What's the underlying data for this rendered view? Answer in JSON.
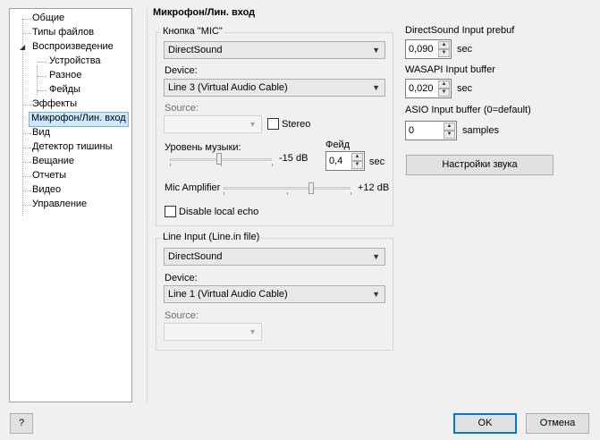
{
  "tree": {
    "items": [
      {
        "label": "Общие"
      },
      {
        "label": "Типы файлов"
      },
      {
        "label": "Воспроизведение",
        "expanded": true
      },
      {
        "label": "Устройства",
        "child": true
      },
      {
        "label": "Разное",
        "child": true
      },
      {
        "label": "Фейды",
        "child": true
      },
      {
        "label": "Эффекты"
      },
      {
        "label": "Микрофон/Лин. вход",
        "selected": true
      },
      {
        "label": "Вид"
      },
      {
        "label": "Детектор тишины"
      },
      {
        "label": "Вещание"
      },
      {
        "label": "Отчеты"
      },
      {
        "label": "Видео"
      },
      {
        "label": "Управление"
      }
    ],
    "expander_icon": "triangle-expanded-icon"
  },
  "section_title": "Микрофон/Лин. вход",
  "mic_group": {
    "title": "Кнопка \"MIC\"",
    "driver": "DirectSound",
    "device_label": "Device:",
    "device": "Line 3 (Virtual Audio Cable)",
    "source_label": "Source:",
    "source": "",
    "stereo_label": "Stereo",
    "stereo_checked": false,
    "music_level_label": "Уровень музыки:",
    "music_level_value": "-15 dB",
    "music_level_fraction": 0.48,
    "fade_label": "Фейд",
    "fade_value": "0,4",
    "fade_unit": "sec",
    "mic_amp_label": "Mic Amplifier",
    "mic_amp_value": "+12 dB",
    "mic_amp_fraction": 0.69,
    "disable_echo_label": "Disable local echo",
    "disable_echo_checked": false
  },
  "line_group": {
    "title": "Line Input (Line.in file)",
    "driver": "DirectSound",
    "device_label": "Device:",
    "device": "Line 1 (Virtual Audio Cable)",
    "source_label": "Source:",
    "source": ""
  },
  "right": {
    "ds_label": "DirectSound Input prebuf",
    "ds_value": "0,090",
    "ds_unit": "sec",
    "wasapi_label": "WASAPI Input buffer",
    "wasapi_value": "0,020",
    "wasapi_unit": "sec",
    "asio_label": "ASIO Input buffer (0=default)",
    "asio_value": "0",
    "asio_unit": "samples",
    "sound_settings_label": "Настройки звука"
  },
  "footer": {
    "help_label": "?",
    "ok_label": "OK",
    "cancel_label": "Отмена"
  }
}
